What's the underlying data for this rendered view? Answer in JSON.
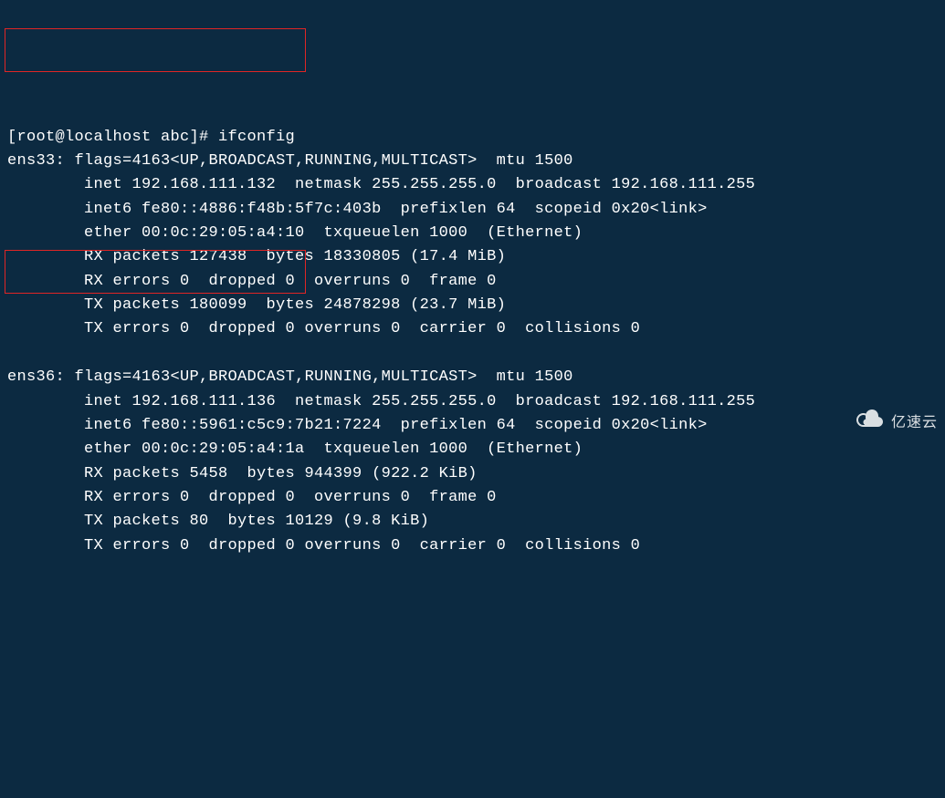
{
  "prompt": "[root@localhost abc]# ",
  "command": "ifconfig",
  "interfaces": [
    {
      "name": "ens33",
      "flags_line": "flags=4163<UP,BROADCAST,RUNNING,MULTICAST>  mtu 1500",
      "inet_line": "inet 192.168.111.132  netmask 255.255.255.0  broadcast 192.168.111.255",
      "inet6_line": "inet6 fe80::4886:f48b:5f7c:403b  prefixlen 64  scopeid 0x20<link>",
      "ether_line": "ether 00:0c:29:05:a4:10  txqueuelen 1000  (Ethernet)",
      "rx_packets": "RX packets 127438  bytes 18330805 (17.4 MiB)",
      "rx_errors": "RX errors 0  dropped 0  overruns 0  frame 0",
      "tx_packets": "TX packets 180099  bytes 24878298 (23.7 MiB)",
      "tx_errors": "TX errors 0  dropped 0 overruns 0  carrier 0  collisions 0"
    },
    {
      "name": "ens36",
      "flags_line": "flags=4163<UP,BROADCAST,RUNNING,MULTICAST>  mtu 1500",
      "inet_line": "inet 192.168.111.136  netmask 255.255.255.0  broadcast 192.168.111.255",
      "inet6_line": "inet6 fe80::5961:c5c9:7b21:7224  prefixlen 64  scopeid 0x20<link>",
      "ether_line": "ether 00:0c:29:05:a4:1a  txqueuelen 1000  (Ethernet)",
      "rx_packets": "RX packets 5458  bytes 944399 (922.2 KiB)",
      "rx_errors": "RX errors 0  dropped 0  overruns 0  frame 0",
      "tx_packets": "TX packets 80  bytes 10129 (9.8 KiB)",
      "tx_errors": "TX errors 0  dropped 0 overruns 0  carrier 0  collisions 0"
    }
  ],
  "watermark": "亿速云"
}
